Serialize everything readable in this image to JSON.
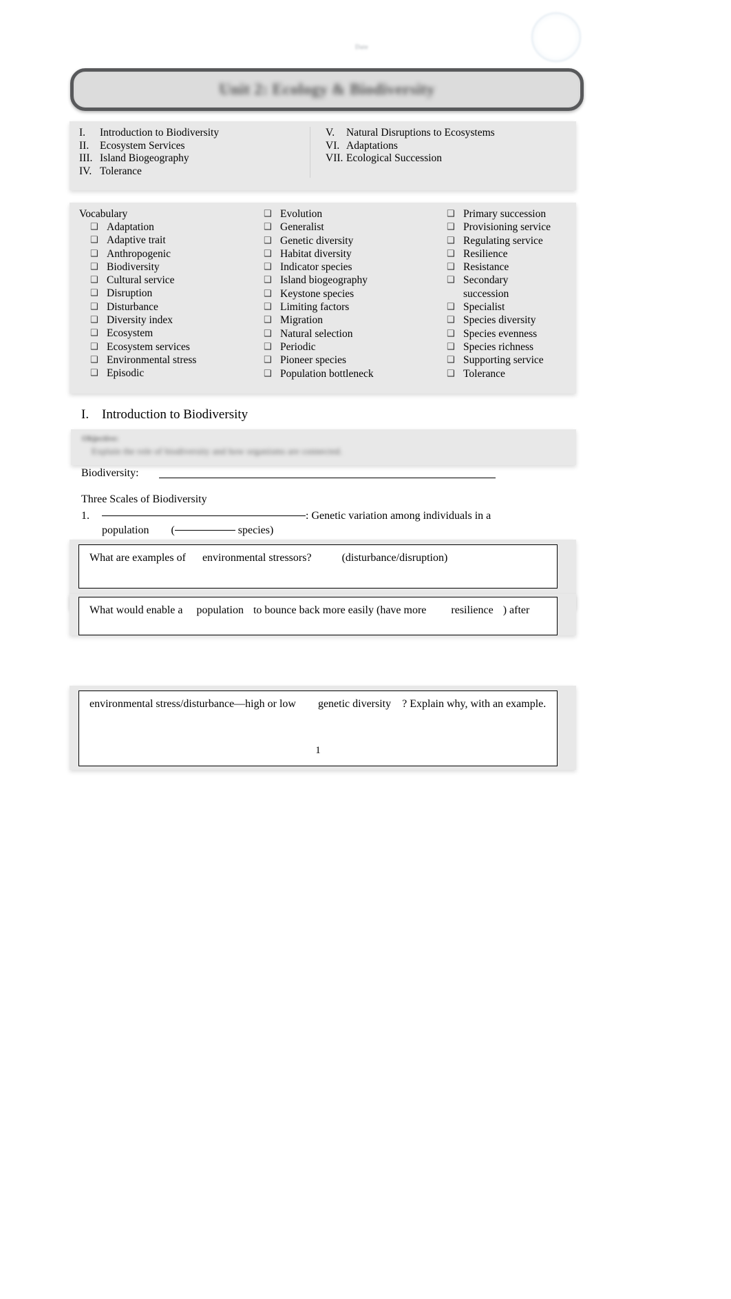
{
  "document": {
    "title_banner": "Unit 2: Ecology & Biodiversity",
    "date_stamp": "Date",
    "page_number": "1"
  },
  "toc": {
    "left": [
      {
        "num": "I.",
        "label": "Introduction to Biodiversity"
      },
      {
        "num": "II.",
        "label": "Ecosystem Services"
      },
      {
        "num": "III.",
        "label": "Island Biogeography"
      },
      {
        "num": "IV.",
        "label": "Tolerance"
      }
    ],
    "right": [
      {
        "num": "V.",
        "label": "Natural Disruptions to Ecosystems"
      },
      {
        "num": "VI.",
        "label": "Adaptations"
      },
      {
        "num": "VII.",
        "label": "Ecological Succession"
      }
    ]
  },
  "vocabulary": {
    "heading": "Vocabulary",
    "bullet_glyph": "❑",
    "column1": [
      "Adaptation",
      "Adaptive trait",
      "Anthropogenic",
      "Biodiversity",
      "Cultural service",
      "Disruption",
      "Disturbance",
      "Diversity index",
      "Ecosystem",
      "Ecosystem services",
      "Environmental stress",
      "Episodic"
    ],
    "column2": [
      "Evolution",
      "Generalist",
      "Genetic diversity",
      "Habitat diversity",
      "Indicator species",
      "Island biogeography",
      "Keystone species",
      "Limiting factors",
      "Migration",
      "Natural selection",
      "Periodic",
      "Pioneer species",
      "Population bottleneck"
    ],
    "column3": [
      "Primary succession",
      "Provisioning service",
      "Regulating service",
      "Resilience",
      "Resistance",
      "Secondary",
      "Specialist",
      "Species diversity",
      "Species evenness",
      "Species richness",
      "Supporting service",
      "Tolerance"
    ],
    "column3_wrap_continuation": "succession"
  },
  "section_one": {
    "num": "I.",
    "title": "Introduction to Biodiversity",
    "objective_label": "Objective:",
    "objective_text": "Explain the role of biodiversity and how organisms are connected."
  },
  "body": {
    "biodiversity_label": "Biodiversity:",
    "three_scales_label": "Three Scales of Biodiversity",
    "scale_one_num": "1.",
    "scale_one_after_blank": ": Genetic variation among individuals in a",
    "scale_one_line2_prefix": "population",
    "scale_one_line2_open": "(",
    "scale_one_line2_close": " species)"
  },
  "questions": [
    {
      "id": "q1",
      "parts": [
        "What are examples of",
        "environmental stressors?",
        "(disturbance/disruption)"
      ]
    },
    {
      "id": "q2",
      "parts": [
        "What would enable a",
        "population",
        "to bounce back more easily (have more",
        "resilience",
        ") after"
      ]
    },
    {
      "id": "q3",
      "parts": [
        "environmental stress/disturbance—high or low",
        "genetic diversity",
        "? Explain why, with an example."
      ]
    }
  ]
}
